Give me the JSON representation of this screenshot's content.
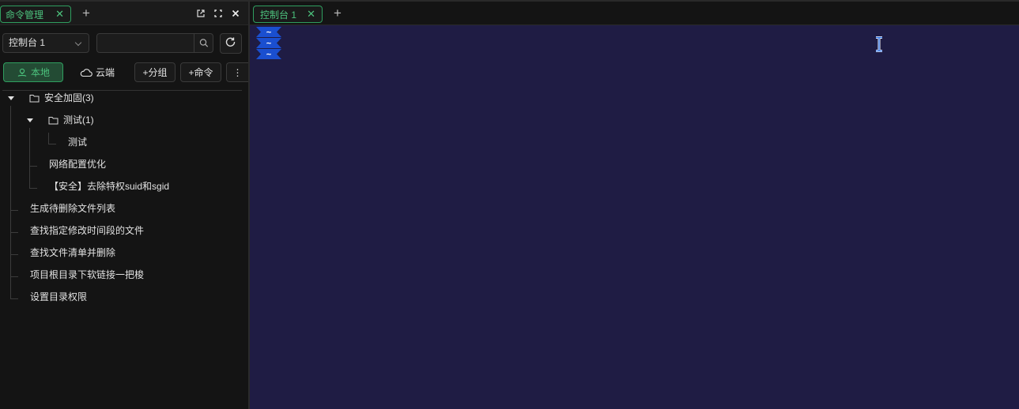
{
  "left_panel": {
    "tab": {
      "label": "命令管理",
      "close": "✕"
    },
    "add_tab": "+",
    "console_select": {
      "value": "控制台 1"
    },
    "search": {
      "placeholder": ""
    },
    "buttons": {
      "local": "本地",
      "cloud": "云端",
      "add_group": "+分组",
      "add_command": "+命令",
      "more": "⋮"
    },
    "tree": [
      {
        "label": "安全加固(3)",
        "type": "folder",
        "expanded": true
      },
      {
        "label": "测试(1)",
        "type": "folder",
        "expanded": true
      },
      {
        "label": "测试",
        "type": "item"
      },
      {
        "label": "网络配置优化",
        "type": "item"
      },
      {
        "label": "【安全】去除特权suid和sgid",
        "type": "item"
      },
      {
        "label": "生成待删除文件列表",
        "type": "item"
      },
      {
        "label": "查找指定修改时间段的文件",
        "type": "item"
      },
      {
        "label": "查找文件清单并删除",
        "type": "item"
      },
      {
        "label": "项目根目录下软链接一把梭",
        "type": "item"
      },
      {
        "label": "设置目录权限",
        "type": "item"
      }
    ]
  },
  "right_panel": {
    "tab": {
      "label": "控制台 1",
      "close": "✕"
    },
    "add_tab": "+",
    "terminal": {
      "lines": [
        "~",
        "~",
        "~"
      ]
    }
  },
  "colors": {
    "accent_green": "#4cc27d",
    "terminal_bg": "#1f1c44",
    "prompt_blue": "#1a4fd0",
    "panel_bg": "#141414"
  },
  "icons": [
    "close-icon",
    "plus-icon",
    "external-link-icon",
    "maximize-icon",
    "chevron-down-icon",
    "search-icon",
    "refresh-icon",
    "user-location-icon",
    "cloud-icon",
    "more-vertical-icon",
    "caret-down-icon",
    "folder-icon",
    "text-cursor-icon"
  ]
}
